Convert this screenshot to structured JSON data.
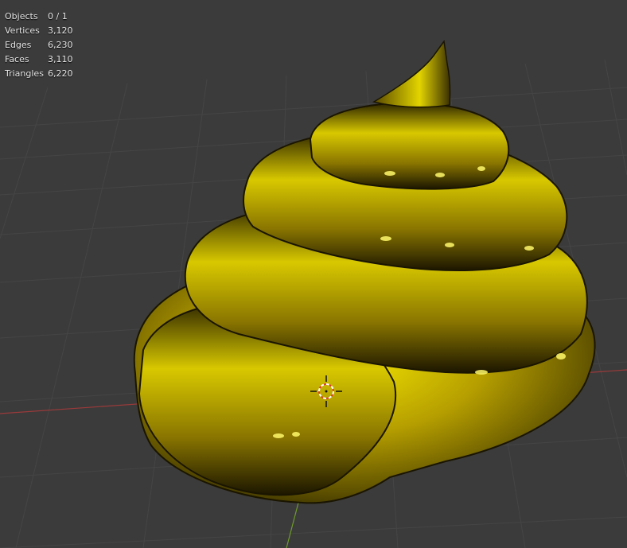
{
  "viewport": {
    "background": "#3b3b3b",
    "grid_color": "#454545",
    "x_axis_color": "#9b3a3a",
    "y_axis_color": "#6f9b2a",
    "object_color": "#d4c200",
    "origin_icon": "3d-cursor-icon"
  },
  "stats": [
    {
      "label": "Objects",
      "value": "0 / 1"
    },
    {
      "label": "Vertices",
      "value": "3,120"
    },
    {
      "label": "Edges",
      "value": "6,230"
    },
    {
      "label": "Faces",
      "value": "3,110"
    },
    {
      "label": "Triangles",
      "value": "6,220"
    }
  ]
}
